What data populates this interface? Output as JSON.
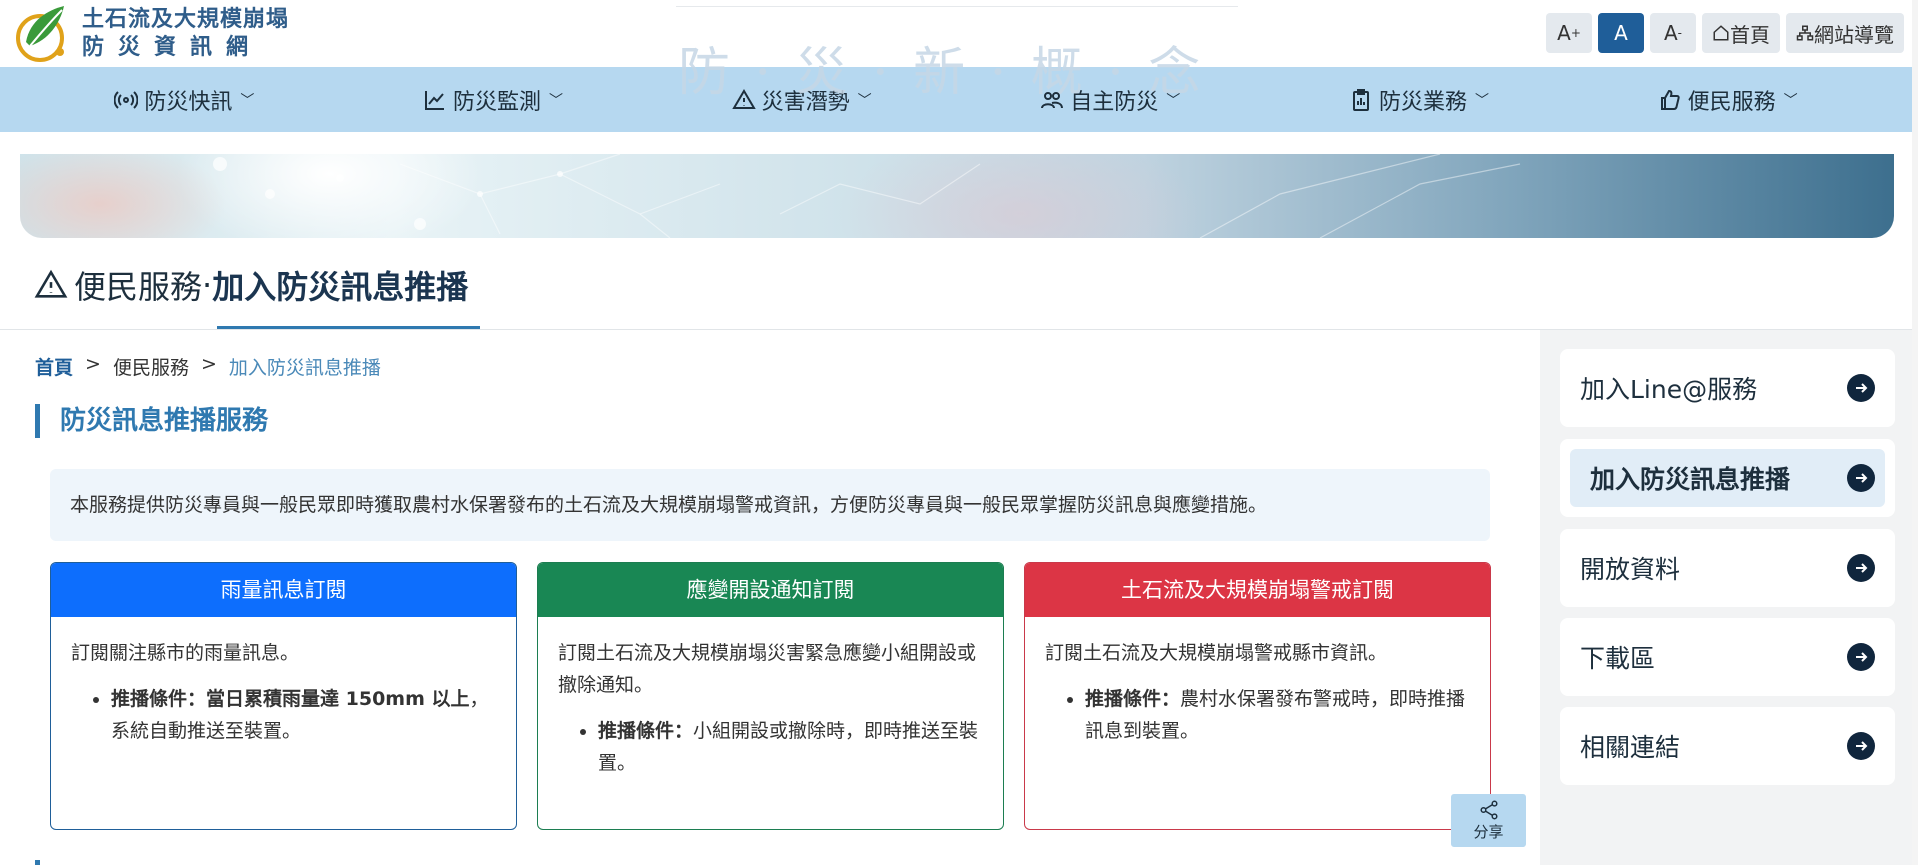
{
  "logo": {
    "line1": "土石流及大規模崩塌",
    "line2": "防災資訊網"
  },
  "slogan": "防 · 災 · 新 · 概 · 念",
  "tools": {
    "font_large": "A",
    "font_normal": "A",
    "font_small": "A",
    "home": "首頁",
    "sitemap": "網站導覽"
  },
  "nav": [
    {
      "label": "防災快訊",
      "icon": "broadcast-icon"
    },
    {
      "label": "防災監測",
      "icon": "chart-line-icon"
    },
    {
      "label": "災害潛勢",
      "icon": "warning-icon"
    },
    {
      "label": "自主防災",
      "icon": "people-icon"
    },
    {
      "label": "防災業務",
      "icon": "clipboard-icon"
    },
    {
      "label": "便民服務",
      "icon": "thumb-up-icon"
    }
  ],
  "title": {
    "parent": "便民服務",
    "separator": "·",
    "current": "加入防災訊息推播"
  },
  "breadcrumb": {
    "home": "首頁",
    "sep": ">",
    "parent": "便民服務",
    "current": "加入防災訊息推播"
  },
  "section_title": "防災訊息推播服務",
  "intro": "本服務提供防災專員與一般民眾即時獲取農村水保署發布的土石流及大規模崩塌警戒資訊，方便防災專員與一般民眾掌握防災訊息與應變措施。",
  "cards": [
    {
      "title": "雨量訊息訂閱",
      "desc": "訂閱關注縣市的雨量訊息。",
      "cond_label": "推播條件：",
      "cond_bold": "當日累積雨量達 150mm 以上",
      "cond_text": "，系統自動推送至裝置。",
      "color": "#0d6efd"
    },
    {
      "title": "應變開設通知訂閱",
      "desc": "訂閱土石流及大規模崩塌災害緊急應變小組開設或撤除通知。",
      "cond_label": "推播條件：",
      "cond_text": "小組開設或撤除時，即時推送至裝置。",
      "color": "#198754"
    },
    {
      "title": "土石流及大規模崩塌警戒訂閱",
      "desc": "訂閱土石流及大規模崩塌警戒縣市資訊。",
      "cond_label": "推播條件：",
      "cond_text": "農村水保署發布警戒時，即時推播訊息到裝置。",
      "color": "#dc3545"
    }
  ],
  "share": "分享",
  "sidebar": [
    {
      "label": "加入Line@服務",
      "active": false
    },
    {
      "label": "加入防災訊息推播",
      "active": true
    },
    {
      "label": "開放資料",
      "active": false
    },
    {
      "label": "下載區",
      "active": false
    },
    {
      "label": "相關連結",
      "active": false
    }
  ]
}
